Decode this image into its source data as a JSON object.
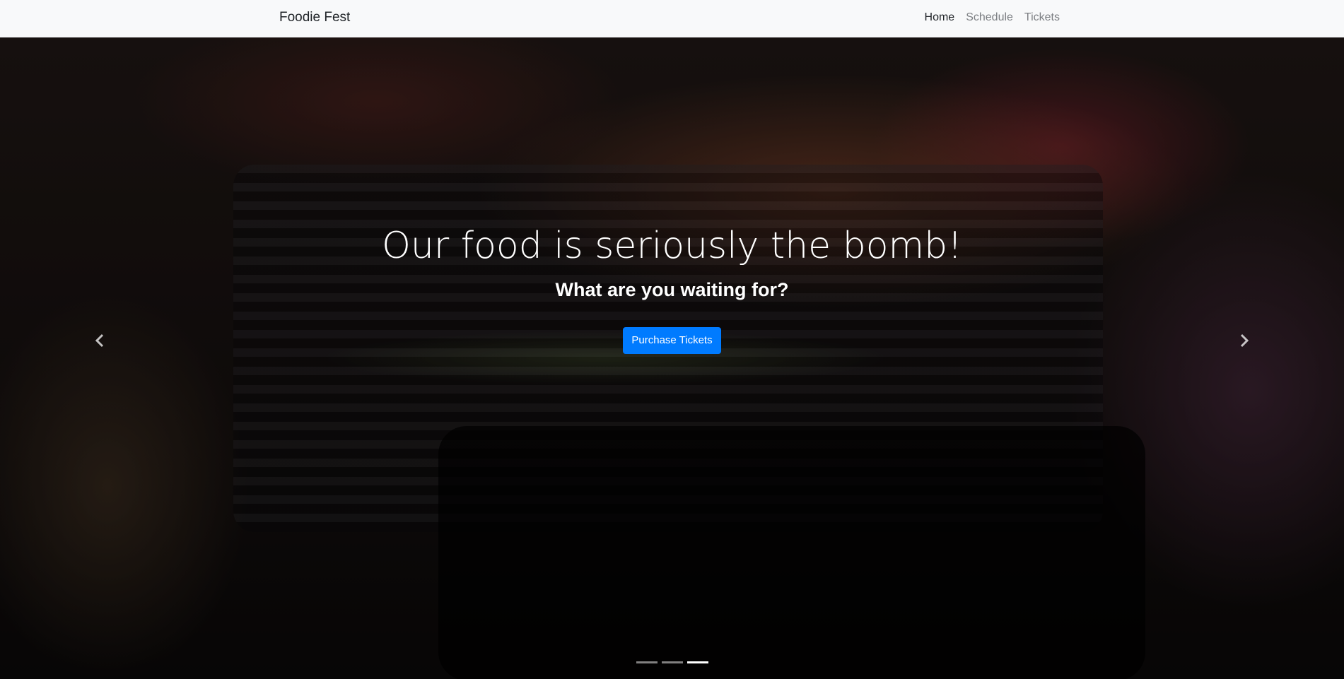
{
  "navbar": {
    "brand": "Foodie Fest",
    "links": [
      {
        "label": "Home",
        "active": true
      },
      {
        "label": "Schedule",
        "active": false
      },
      {
        "label": "Tickets",
        "active": false
      }
    ]
  },
  "hero": {
    "headline": "Our food is seriously the bomb!",
    "subheadline": "What are you waiting for?",
    "cta_label": "Purchase Tickets",
    "prev_icon": "chevron-left-icon",
    "next_icon": "chevron-right-icon",
    "slides_total": 3,
    "active_slide": 3
  },
  "colors": {
    "navbar_bg": "#f8f9fa",
    "accent": "#007bff",
    "nav_active": "#212529",
    "nav_inactive": "#7c7f83"
  }
}
